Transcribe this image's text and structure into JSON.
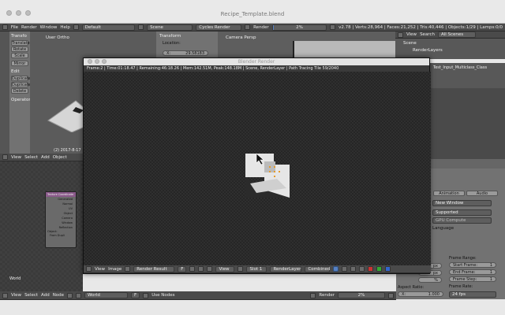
{
  "window": {
    "title": "Recipe_Template.blend"
  },
  "topbar": {
    "menus": [
      "File",
      "Render",
      "Window",
      "Help"
    ],
    "layout": "Default",
    "scene": "Scene",
    "engine": "Cycles Render",
    "render_label": "Render",
    "progress_text": "2%",
    "progress": 0.02,
    "stats": "v2.78 | Verts:28,964 | Faces:21,252 | Tris:40,446 | Objects:1/29 | Lamps:0/0"
  },
  "toolshelf": {
    "transform_header": "Transfo",
    "transform_buttons": [
      "Translate",
      "Rotate",
      "Scale",
      "Mirror"
    ],
    "edit_header": "Edit",
    "edit_buttons": [
      "Duplicate",
      "Duplicate",
      "Delete"
    ],
    "operator_header": "Operator"
  },
  "viewport1": {
    "title": "User Ortho",
    "timestamp": "(2) 2017-8-17"
  },
  "properties_n": {
    "header": "Transform",
    "location_label": "Location:",
    "x_label": "X:",
    "x_value": "29.58183"
  },
  "viewport2": {
    "title": "Camera Persp"
  },
  "outliner": {
    "menus": [
      "View",
      "Search"
    ],
    "filter": "All Scenes",
    "items": [
      "Scene",
      "RenderLayers"
    ],
    "object": "Test_Input_Multiclass_Class"
  },
  "render_window": {
    "title": "Blender Render",
    "info": "Frame:2 | Time:01:18.47 | Remaining:46:18.26 | Mem:142.51M, Peak:148.18M | Scene, RenderLayer | Path Tracing Tile 59/2040",
    "footer": {
      "menus": [
        "View",
        "Image"
      ],
      "image": "Render Result",
      "f_label": "F",
      "view_dropdown": "View",
      "slot": "Slot 1",
      "layer": "RenderLayer",
      "pass": "Combined"
    }
  },
  "node_editor": {
    "menus": [
      "View",
      "Select",
      "Add",
      "Object"
    ],
    "world_label": "World",
    "node_title": "Texture Coordinate",
    "node_outputs": [
      "Generated",
      "Normal",
      "UV",
      "Object",
      "Camera",
      "Window",
      "Reflection"
    ],
    "node_object_label": "Object:",
    "node_checkbox": "From Dupli"
  },
  "bottom_bar": {
    "menus": [
      "View",
      "Select",
      "Add",
      "Node"
    ],
    "world": "World",
    "f_label": "F",
    "use_nodes": "Use Nodes",
    "render_label": "Render",
    "progress_text": "2%"
  },
  "prefs": {
    "tabs": [
      "Animation",
      "Audio"
    ],
    "new_window": "New Window",
    "supported": "Supported",
    "gpu": "GPU Compute",
    "language": "Language"
  },
  "output_props": {
    "aspect_label": "Aspect Ratio:",
    "x_label": "X:",
    "x_value": "1.000",
    "frame_range": "Frame Range:",
    "start_frame": "Start Frame:",
    "start_value": "1",
    "end_frame": "End Frame:",
    "end_value": "1",
    "frame_step": "Frame Step:",
    "step_value": "1",
    "frame_rate": "Frame Rate:",
    "fps": "24 fps",
    "percent": "px",
    "resolution_values": [
      "px",
      "px",
      "%"
    ]
  }
}
